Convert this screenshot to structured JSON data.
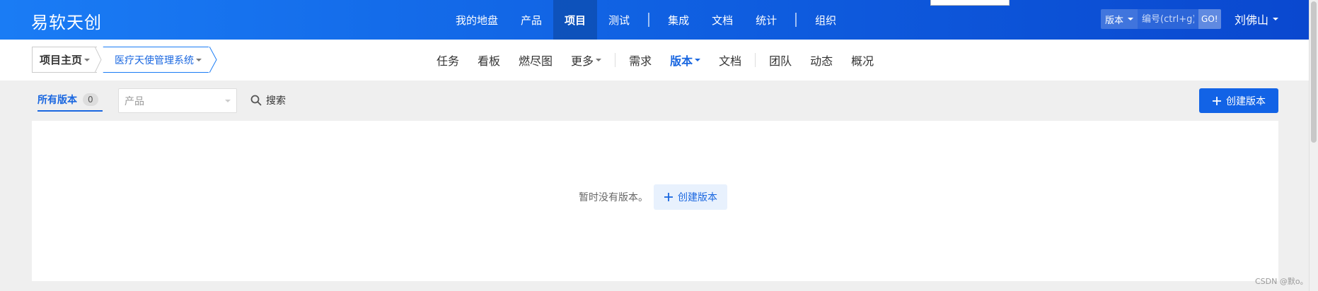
{
  "header": {
    "brand": "易软天创",
    "nav": [
      {
        "label": "我的地盘"
      },
      {
        "label": "产品"
      },
      {
        "label": "项目",
        "active": true
      },
      {
        "label": "测试"
      },
      {
        "label": "集成"
      },
      {
        "label": "文档"
      },
      {
        "label": "统计"
      },
      {
        "label": "组织"
      }
    ],
    "search": {
      "type_label": "版本",
      "placeholder": "编号(ctrl+g)",
      "go_label": "GO!"
    },
    "user_name": "刘佛山"
  },
  "subheader": {
    "breadcrumb_home": "项目主页",
    "breadcrumb_project": "医疗天使管理系统",
    "nav": [
      {
        "label": "任务"
      },
      {
        "label": "看板"
      },
      {
        "label": "燃尽图"
      },
      {
        "label": "更多"
      },
      {
        "label": "需求"
      },
      {
        "label": "版本",
        "active": true
      },
      {
        "label": "文档"
      },
      {
        "label": "团队"
      },
      {
        "label": "动态"
      },
      {
        "label": "概况"
      }
    ]
  },
  "toolbar": {
    "tab_all_label": "所有版本",
    "tab_all_count": "0",
    "product_placeholder": "产品",
    "search_label": "搜索",
    "create_label": "创建版本"
  },
  "main": {
    "empty_text": "暂时没有版本。",
    "empty_create_label": "创建版本"
  },
  "watermark": "CSDN @默o。",
  "colors": {
    "accent": "#1263e6",
    "header_start": "#1a7cf5",
    "header_end": "#0a48cf"
  }
}
